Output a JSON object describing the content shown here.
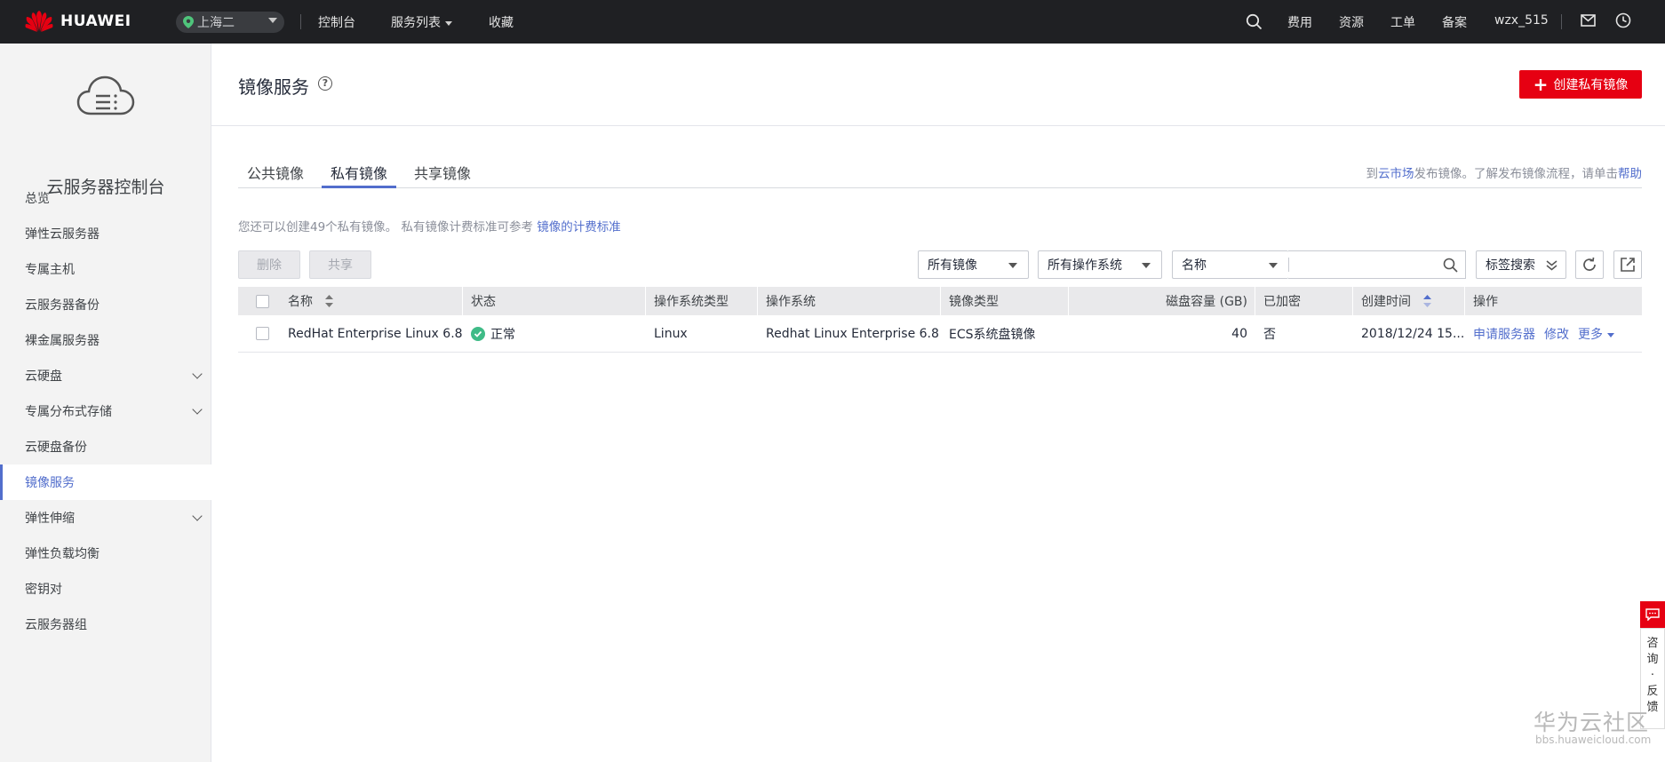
{
  "topbar": {
    "brand": "HUAWEI",
    "region": "上海二",
    "nav": [
      "控制台",
      "服务列表",
      "收藏"
    ],
    "right_links": [
      "费用",
      "资源",
      "工单",
      "备案"
    ],
    "username": "wzx_515"
  },
  "sidebar": {
    "title": "云服务器控制台",
    "items": [
      {
        "label": "总览",
        "expandable": false
      },
      {
        "label": "弹性云服务器",
        "expandable": false
      },
      {
        "label": "专属主机",
        "expandable": false
      },
      {
        "label": "云服务器备份",
        "expandable": false
      },
      {
        "label": "裸金属服务器",
        "expandable": false
      },
      {
        "label": "云硬盘",
        "expandable": true
      },
      {
        "label": "专属分布式存储",
        "expandable": true
      },
      {
        "label": "云硬盘备份",
        "expandable": false
      },
      {
        "label": "镜像服务",
        "expandable": false,
        "active": true
      },
      {
        "label": "弹性伸缩",
        "expandable": true
      },
      {
        "label": "弹性负载均衡",
        "expandable": false
      },
      {
        "label": "密钥对",
        "expandable": false
      },
      {
        "label": "云服务器组",
        "expandable": false
      }
    ]
  },
  "page": {
    "title": "镜像服务",
    "create_button": "创建私有镜像",
    "tabs": [
      "公共镜像",
      "私有镜像",
      "共享镜像"
    ],
    "active_tab": "私有镜像",
    "tab_hint": {
      "prefix": "到",
      "market_link": "云市场",
      "middle": "发布镜像。了解发布镜像流程，请单击",
      "help_link": "帮助"
    },
    "info": {
      "text": "您还可以创建49个私有镜像。 私有镜像计费标准可参考 ",
      "link": "镜像的计费标准"
    }
  },
  "toolbar": {
    "delete_label": "删除",
    "share_label": "共享",
    "filter_image": "所有镜像",
    "filter_os": "所有操作系统",
    "search_field": "名称",
    "search_value": "",
    "tag_search": "标签搜索"
  },
  "table": {
    "headers": [
      "名称",
      "状态",
      "操作系统类型",
      "操作系统",
      "镜像类型",
      "磁盘容量 (GB)",
      "已加密",
      "创建时间",
      "操作"
    ],
    "rows": [
      {
        "name": "RedHat Enterprise Linux 6.8",
        "status": "正常",
        "os_type": "Linux",
        "os": "Redhat Linux Enterprise 6.8 ...",
        "image_type": "ECS系统盘镜像",
        "disk_gb": "40",
        "encrypted": "否",
        "created": "2018/12/24 15...",
        "actions": [
          "申请服务器",
          "修改",
          "更多"
        ]
      }
    ]
  },
  "widget": {
    "consult_label": [
      "咨",
      "询",
      "·",
      "反",
      "馈"
    ]
  },
  "watermark": {
    "text": "华为云社区",
    "url": "bbs.huaweicloud.com"
  },
  "colors": {
    "topbar_bg": "#1f2023",
    "brand_red": "#e60012",
    "link_blue": "#526ecc",
    "status_green": "#3fbb87"
  }
}
